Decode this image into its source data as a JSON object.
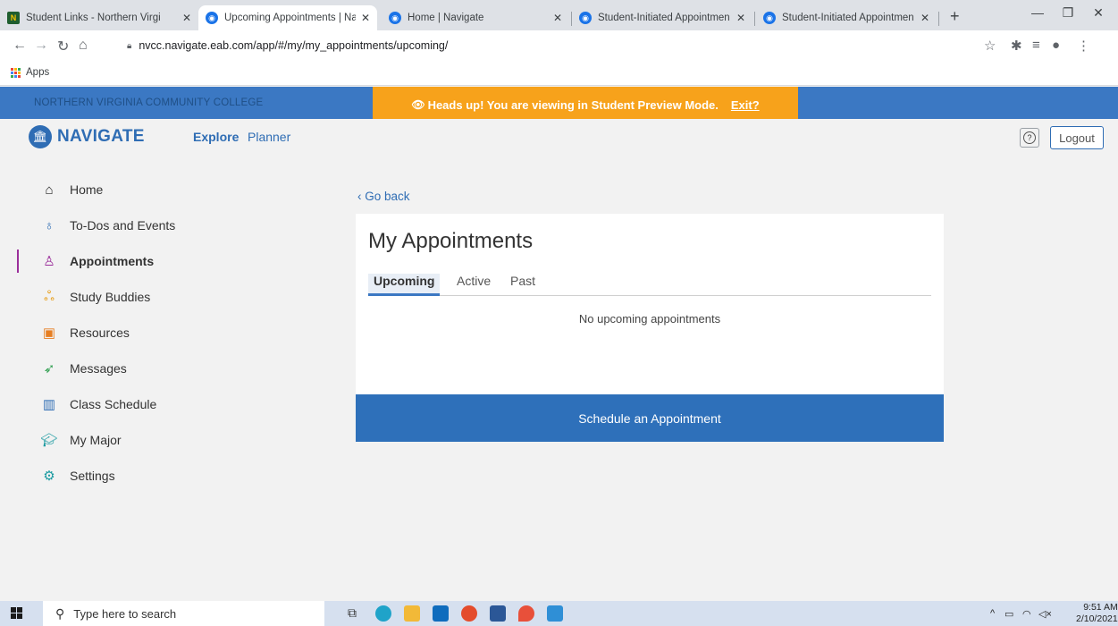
{
  "browser": {
    "tabs": [
      {
        "title": "Student Links - Northern Virgi",
        "favicon": "nvcc-favicon"
      },
      {
        "title": "Upcoming Appointments | Na",
        "favicon": "navigate-favicon"
      },
      {
        "title": "Home | Navigate",
        "favicon": "navigate-favicon"
      },
      {
        "title": "Student-Initiated Appointmen",
        "favicon": "navigate-favicon"
      },
      {
        "title": "Student-Initiated Appointmen",
        "favicon": "navigate-favicon"
      }
    ],
    "active_tab_index": 1,
    "url": "nvcc.navigate.eab.com/app/#/my/my_appointments/upcoming/",
    "bookmarks_apps_label": "Apps"
  },
  "header": {
    "college_name": "NORTHERN VIRGINIA COMMUNITY COLLEGE",
    "banner_text": "Heads up! You are viewing in Student Preview Mode.",
    "banner_exit": "Exit?",
    "logo_text": "NAVIGATE",
    "nav_links": [
      "Explore",
      "Planner"
    ],
    "help_label": "?",
    "logout_label": "Logout"
  },
  "sidebar": {
    "items": [
      {
        "label": "Home",
        "icon": "home-icon",
        "active": false
      },
      {
        "label": "To-Dos and Events",
        "icon": "apple-icon",
        "active": false
      },
      {
        "label": "Appointments",
        "icon": "person-icon",
        "active": true
      },
      {
        "label": "Study Buddies",
        "icon": "group-icon",
        "active": false
      },
      {
        "label": "Resources",
        "icon": "contact-card-icon",
        "active": false
      },
      {
        "label": "Messages",
        "icon": "paper-plane-icon",
        "active": false
      },
      {
        "label": "Class Schedule",
        "icon": "book-icon",
        "active": false
      },
      {
        "label": "My Major",
        "icon": "graduation-cap-icon",
        "active": false
      },
      {
        "label": "Settings",
        "icon": "gear-icon",
        "active": false
      }
    ]
  },
  "main": {
    "go_back": "Go back",
    "title": "My Appointments",
    "tabs": [
      "Upcoming",
      "Active",
      "Past"
    ],
    "active_tab": "Upcoming",
    "empty_message": "No upcoming appointments",
    "schedule_button": "Schedule an Appointment"
  },
  "taskbar": {
    "search_placeholder": "Type here to search",
    "time": "9:51 AM",
    "date": "2/10/2021"
  },
  "colors": {
    "brand_blue": "#2f6db4",
    "banner_orange": "#f7a21b",
    "active_marker": "#9b2f9b"
  }
}
